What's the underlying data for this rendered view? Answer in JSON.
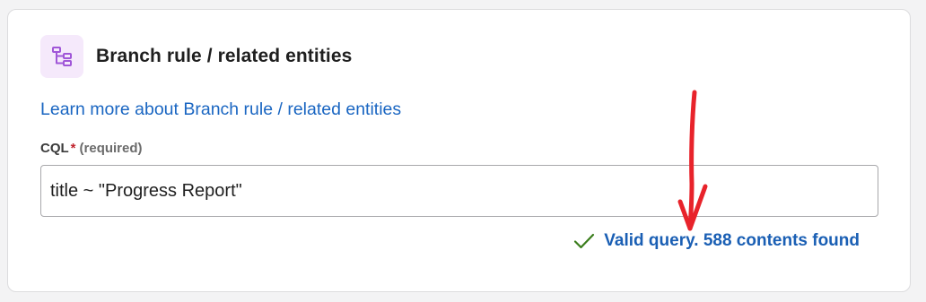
{
  "section": {
    "title": "Branch rule / related entities",
    "icon": "branch-hierarchy-icon",
    "icon_color": "#a056d8",
    "icon_bg": "#f5e9fb"
  },
  "learn_more": {
    "label": "Learn more about Branch rule / related entities"
  },
  "cql_field": {
    "label": "CQL",
    "required_marker": "*",
    "required_text": "(required)",
    "value": "title ~ \"Progress Report\""
  },
  "validation": {
    "status": "valid",
    "message": "Valid query. 588 contents found",
    "check_color": "#3a7d1c",
    "text_color": "#1a5fb4"
  },
  "annotation": {
    "type": "hand-drawn-arrow",
    "color": "#e8232b"
  }
}
